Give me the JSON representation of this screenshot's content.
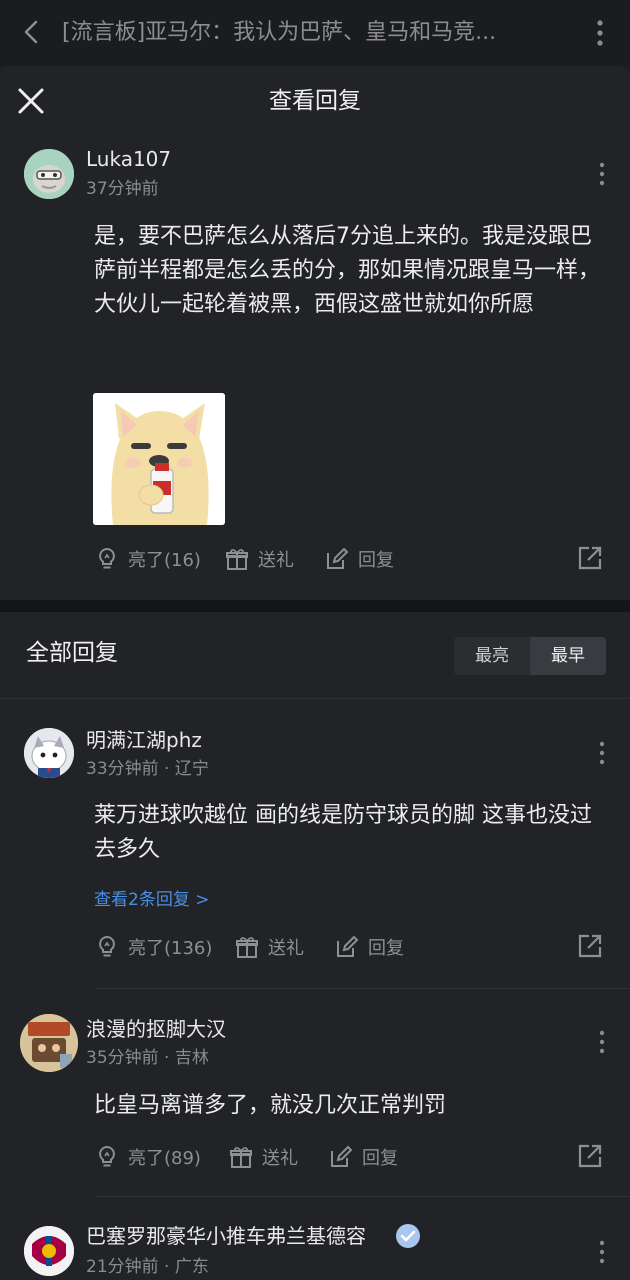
{
  "topbar": {
    "title": "[流言板]亚马尔：我认为巴萨、皇马和马竞..."
  },
  "sheet": {
    "title": "查看回复"
  },
  "main_comment": {
    "username": "Luka107",
    "time": "37分钟前",
    "text": "是，要不巴萨怎么从落后7分追上来的。我是没跟巴萨前半程都是怎么丢的分，那如果情况跟皇马一样，大伙儿一起轮着被黑，西假这盛世就如你所愿",
    "likes": "亮了(16)",
    "gift": "送礼",
    "reply": "回复"
  },
  "all_replies": {
    "title": "全部回复",
    "sort_options": [
      "最亮",
      "最早"
    ],
    "sort_selected": "最早"
  },
  "replies": [
    {
      "username": "明满江湖phz",
      "meta": "33分钟前 · 辽宁",
      "text": "莱万进球吹越位 画的线是防守球员的脚 这事也没过去多久",
      "view_replies": "查看2条回复 >",
      "likes": "亮了(136)",
      "gift": "送礼",
      "reply": "回复"
    },
    {
      "username": "浪漫的抠脚大汉",
      "meta": "35分钟前 · 吉林",
      "text": "比皇马离谱多了，就没几次正常判罚",
      "likes": "亮了(89)",
      "gift": "送礼",
      "reply": "回复"
    },
    {
      "username": "巴塞罗那豪华小推车弗兰基德容",
      "meta": "21分钟前 · 广东"
    }
  ],
  "colors": {
    "background": "#222327",
    "link": "#4a8fe2",
    "muted": "#8a8b90"
  }
}
